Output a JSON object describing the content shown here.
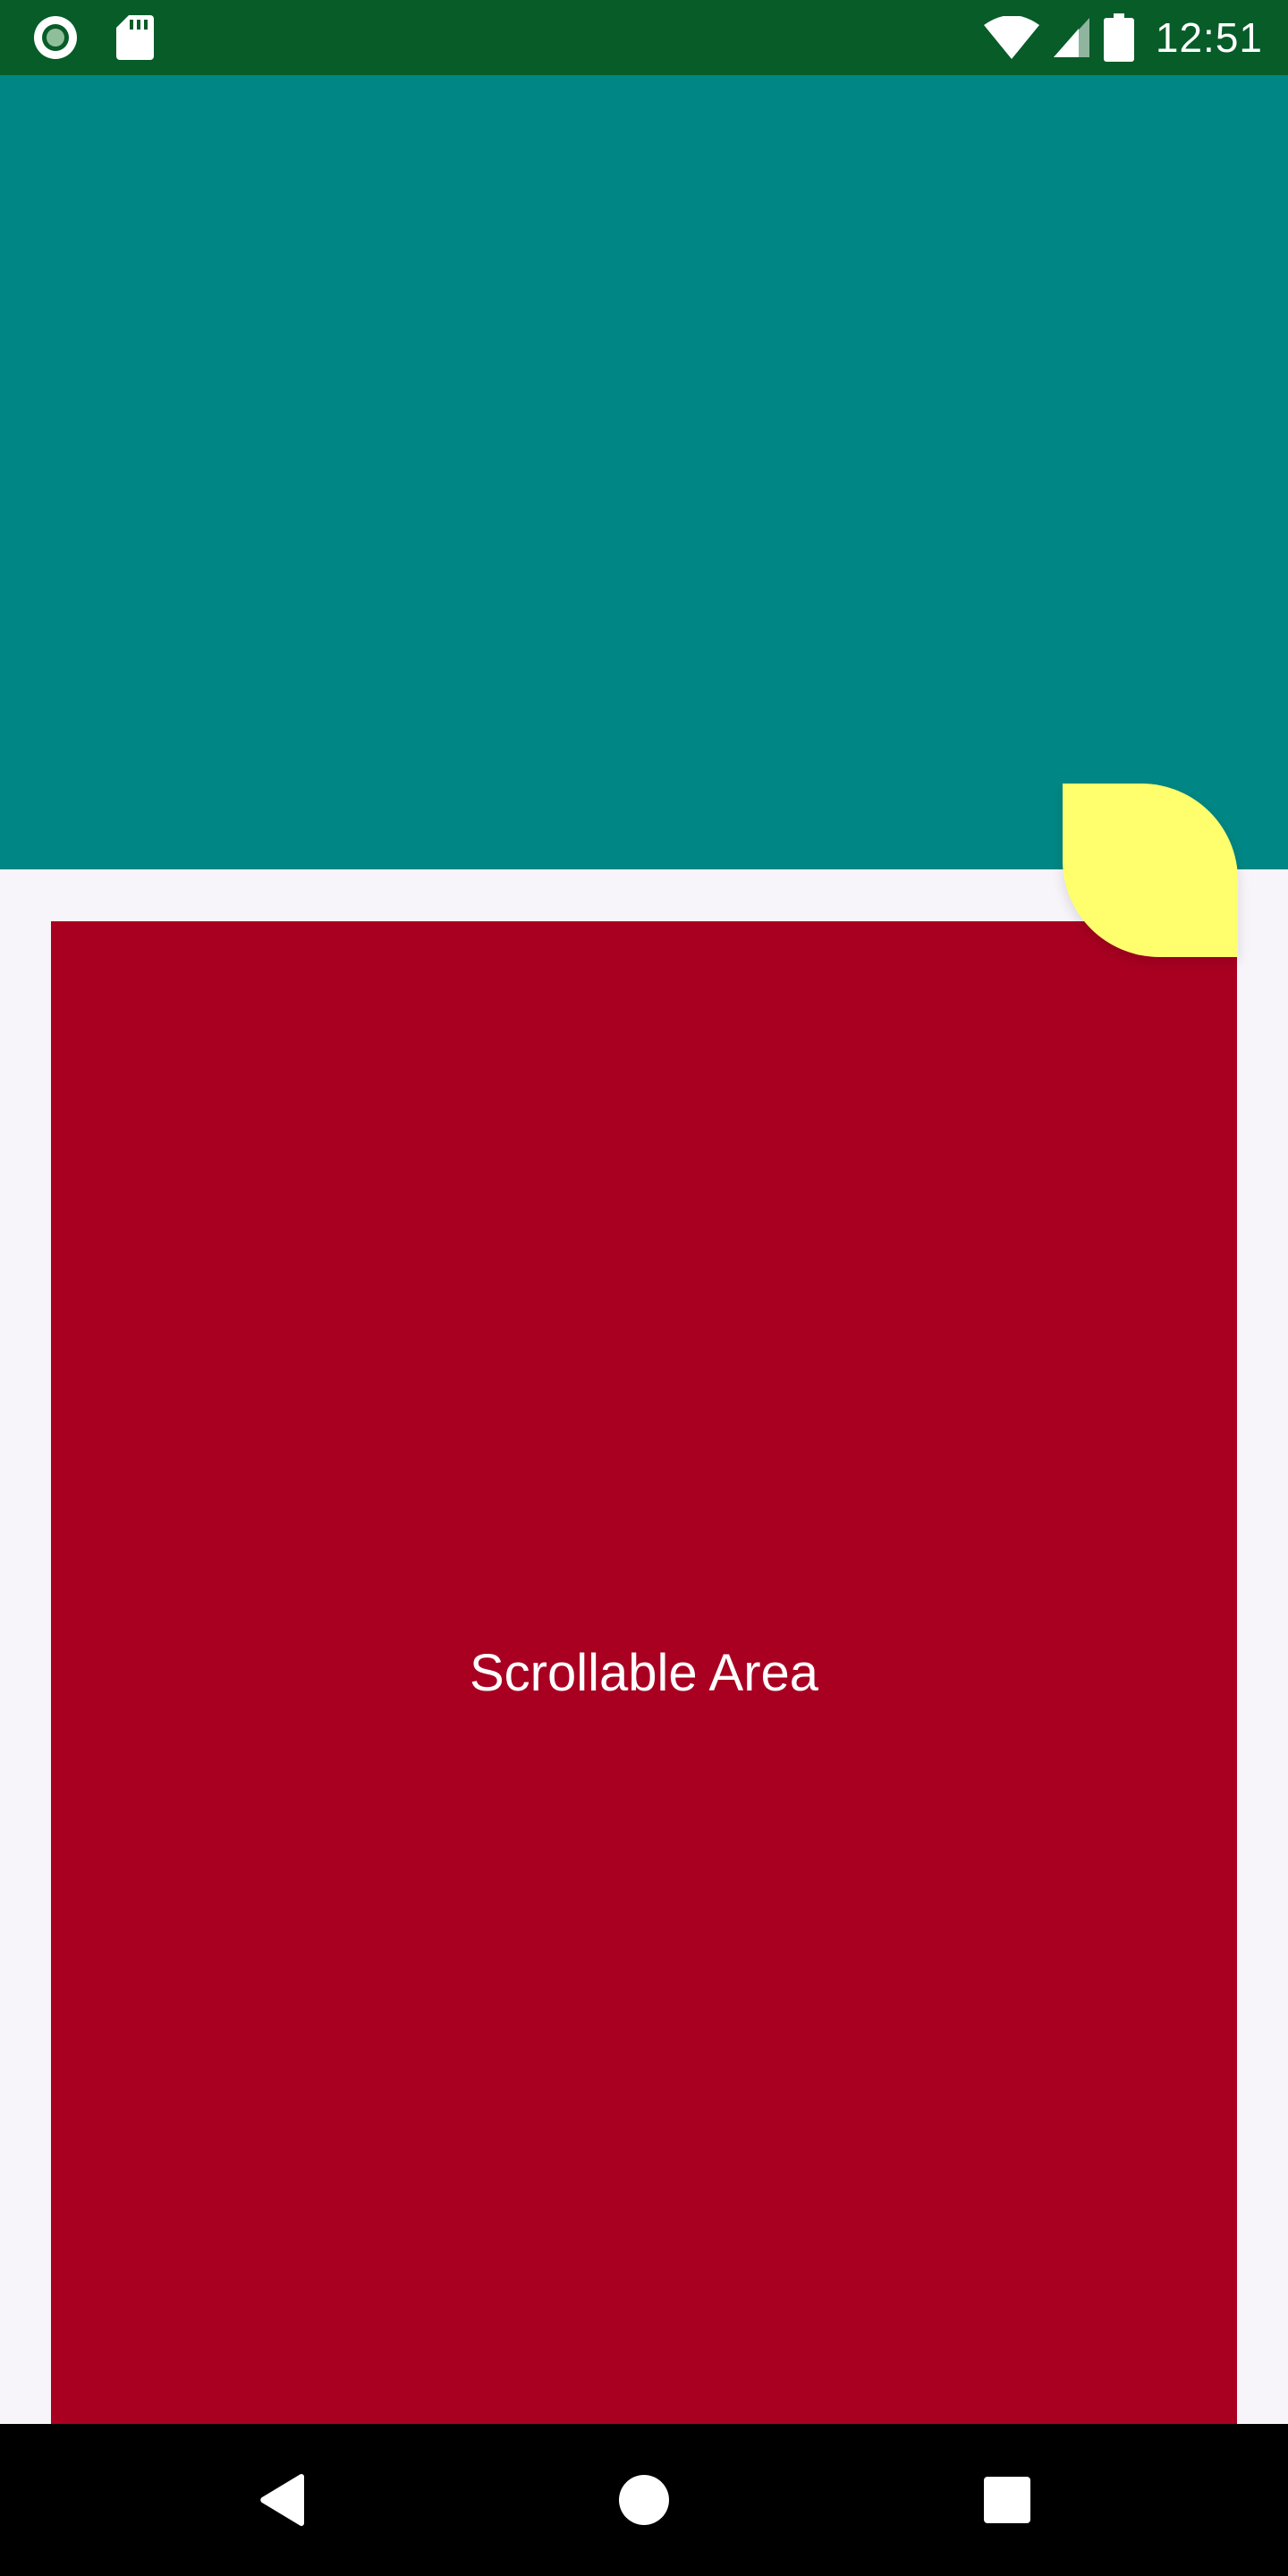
{
  "status_bar": {
    "time": "12:51",
    "icons": [
      "circle-notification-icon",
      "sd-card-icon",
      "wifi-icon",
      "cell-signal-icon",
      "battery-icon"
    ]
  },
  "colors": {
    "status_bar": "#075c28",
    "header": "#008785",
    "scroll_area": "#a90021",
    "leaf": "#ffff6e",
    "background": "#f7f5f9",
    "nav_bar": "#000000"
  },
  "scroll_area": {
    "label": "Scrollable Area"
  },
  "nav_bar": {
    "buttons": [
      "back-icon",
      "home-icon",
      "recents-icon"
    ]
  }
}
